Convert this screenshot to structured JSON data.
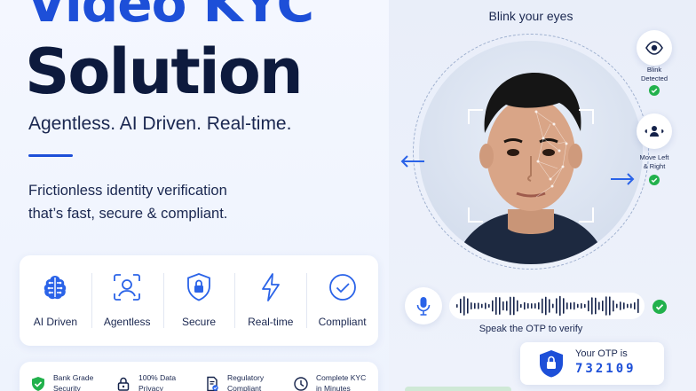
{
  "hero": {
    "line1": "Video KYC",
    "line2": "Solution",
    "tagline": "Agentless. AI Driven. Real-time.",
    "description": [
      "Frictionless identity verification",
      "that’s fast, secure & compliant."
    ]
  },
  "features": [
    {
      "label": "AI Driven",
      "icon": "brain-icon"
    },
    {
      "label": "Agentless",
      "icon": "face-scan-icon"
    },
    {
      "label": "Secure",
      "icon": "shield-lock-icon"
    },
    {
      "label": "Real-time",
      "icon": "lightning-icon"
    },
    {
      "label": "Compliant",
      "icon": "check-circle-icon"
    }
  ],
  "badges": [
    {
      "line1": "Bank Grade",
      "line2": "Security",
      "icon": "shield-check-icon"
    },
    {
      "line1": "100% Data",
      "line2": "Privacy",
      "icon": "lock-icon"
    },
    {
      "line1": "Regulatory",
      "line2": "Compliant",
      "icon": "document-check-icon"
    },
    {
      "line1": "Complete KYC",
      "line2": "in Minutes",
      "icon": "clock-icon"
    }
  ],
  "verification": {
    "prompt": "Blink your eyes",
    "blink": {
      "line1": "Blink",
      "line2": "Detected"
    },
    "move": {
      "line1": "Move Left",
      "line2": "& Right"
    },
    "speak_prompt": "Speak the OTP to verify",
    "otp_title": "Your OTP is",
    "otp_code": "732109"
  },
  "colors": {
    "brand_blue": "#1d4fd8",
    "navy": "#0d1a3d",
    "success_green": "#22b14c"
  }
}
